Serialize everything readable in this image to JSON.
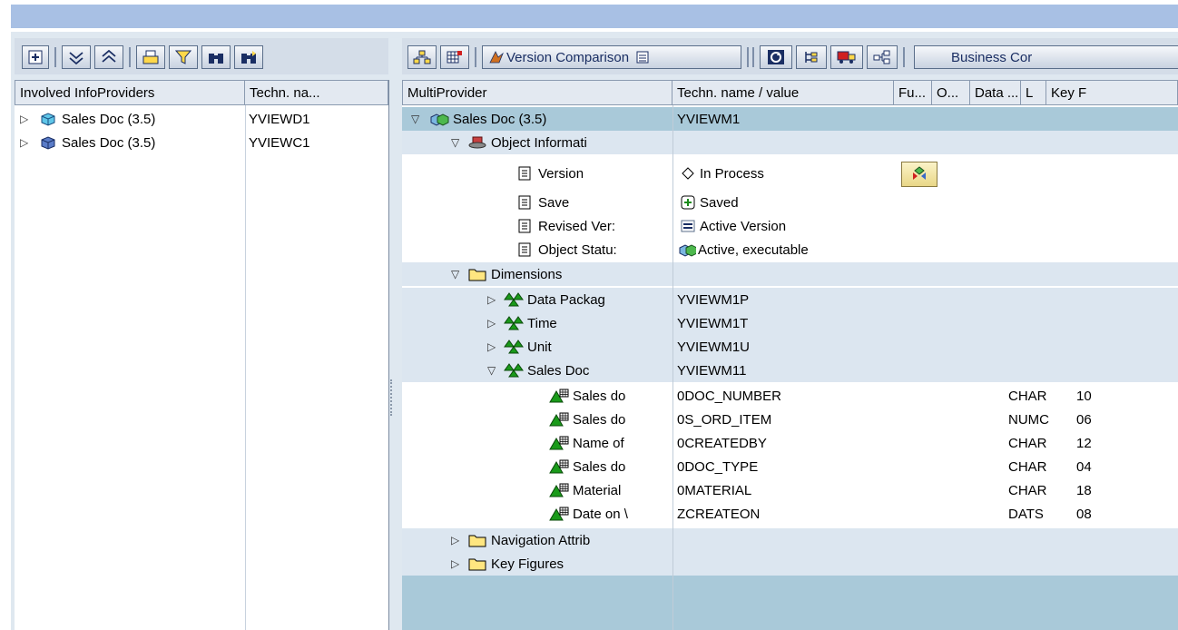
{
  "left_pane": {
    "columns": [
      "Involved InfoProviders",
      "Techn. na..."
    ],
    "rows": [
      {
        "name": "Sales Doc (3.5)",
        "tech": "YVIEWD1",
        "icon": "cube-cyan-icon"
      },
      {
        "name": "Sales Doc (3.5)",
        "tech": "YVIEWC1",
        "icon": "cube-blue-icon"
      }
    ]
  },
  "toolbar_right": {
    "version_comparison_label": "Version Comparison",
    "business_content_label": "Business Cor"
  },
  "right_pane": {
    "columns": [
      "MultiProvider",
      "Techn. name / value",
      "Fu...",
      "O...",
      "Data ...",
      "L",
      "Key F"
    ],
    "root": {
      "name": "Sales Doc (3.5)",
      "tech": "YVIEWM1"
    },
    "object_information": {
      "label": "Object Informati",
      "items": [
        {
          "name": "Version",
          "value": "In Process",
          "value_icon": "diamond-icon"
        },
        {
          "name": "Save",
          "value": "Saved",
          "value_icon": "plus-box-icon"
        },
        {
          "name": "Revised Ver:",
          "value": "Active Version",
          "value_icon": "equals-icon"
        },
        {
          "name": "Object Statu:",
          "value": "Active, executable",
          "value_icon": "multiprovider-icon"
        }
      ]
    },
    "dimensions": {
      "label": "Dimensions",
      "items": [
        {
          "name": "Data Packag",
          "tech": "YVIEWM1P"
        },
        {
          "name": "Time",
          "tech": "YVIEWM1T"
        },
        {
          "name": "Unit",
          "tech": "YVIEWM1U"
        },
        {
          "name": "Sales Doc",
          "tech": "YVIEWM11"
        }
      ],
      "characteristics": [
        {
          "name": "Sales do",
          "tech": "0DOC_NUMBER",
          "type": "CHAR",
          "len": "10"
        },
        {
          "name": "Sales do",
          "tech": "0S_ORD_ITEM",
          "type": "NUMC",
          "len": "06"
        },
        {
          "name": "Name of",
          "tech": "0CREATEDBY",
          "type": "CHAR",
          "len": "12"
        },
        {
          "name": "Sales do",
          "tech": "0DOC_TYPE",
          "type": "CHAR",
          "len": "04"
        },
        {
          "name": "Material",
          "tech": "0MATERIAL",
          "type": "CHAR",
          "len": "18"
        },
        {
          "name": "Date on \\",
          "tech": "ZCREATEON",
          "type": "DATS",
          "len": "08"
        }
      ]
    },
    "navigation_attributes_label": "Navigation Attrib",
    "key_figures_label": "Key Figures"
  },
  "colors": {
    "selected_row": "#a9c9d9",
    "group_row": "#dce6f0",
    "empty_area": "#a9c9d9",
    "title_band": "#a8c0e4"
  }
}
